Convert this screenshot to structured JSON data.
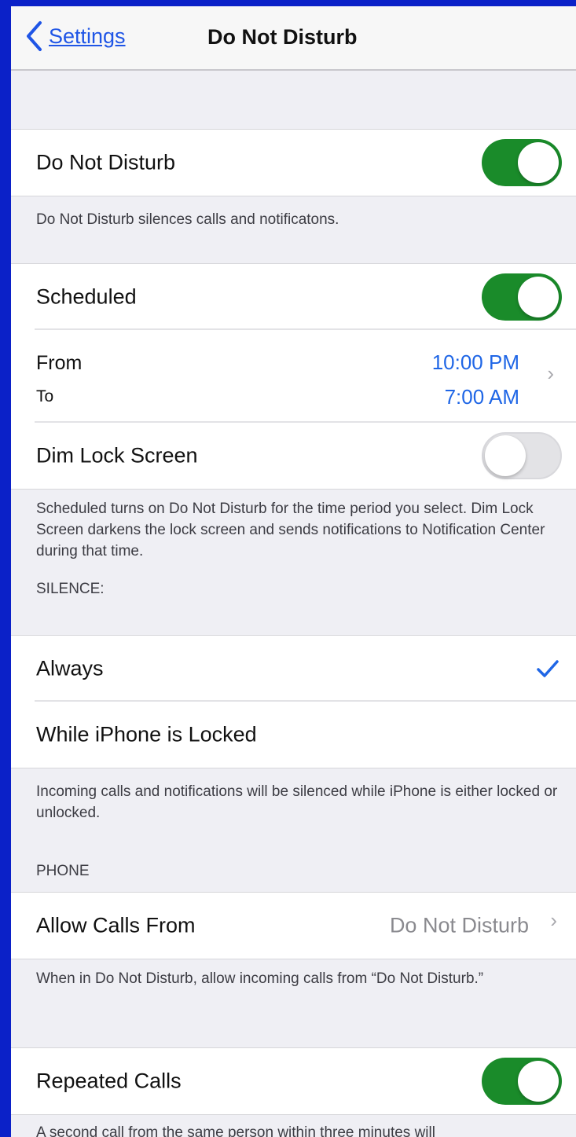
{
  "navbar": {
    "back_label": "Settings",
    "title": "Do Not Disturb"
  },
  "dnd": {
    "label": "Do Not Disturb",
    "enabled": true,
    "footer": "Do Not Disturb silences calls and notificatons."
  },
  "schedule": {
    "scheduled_label": "Scheduled",
    "scheduled_enabled": true,
    "from_label": "From",
    "from_value": "10:00 PM",
    "to_label": "To",
    "to_value": "7:00 AM",
    "dim_label": "Dim Lock Screen",
    "dim_enabled": false,
    "footer": "Scheduled turns on Do Not Disturb for the time period you select. Dim Lock Screen darkens the lock screen and sends notifications to Notification Center during that time."
  },
  "silence": {
    "header": "SILENCE:",
    "options": [
      "Always",
      "While iPhone is Locked"
    ],
    "selected": "Always",
    "footer": "Incoming calls and notifications will be silenced while iPhone is either locked or unlocked."
  },
  "phone": {
    "header": "PHONE",
    "allow_label": "Allow Calls From",
    "allow_value": "Do Not Disturb",
    "footer": "When in Do Not Disturb, allow incoming calls from “Do Not Disturb.”"
  },
  "repeated": {
    "label": "Repeated Calls",
    "enabled": true,
    "footer": "A second call from the same person within three minutes will"
  },
  "colors": {
    "frame": "#0b21c8",
    "toggle_on": "#1a8b2a",
    "accent": "#1f66e6"
  },
  "icons": [
    "chevron-left-icon",
    "chevron-right-icon",
    "checkmark-icon"
  ]
}
